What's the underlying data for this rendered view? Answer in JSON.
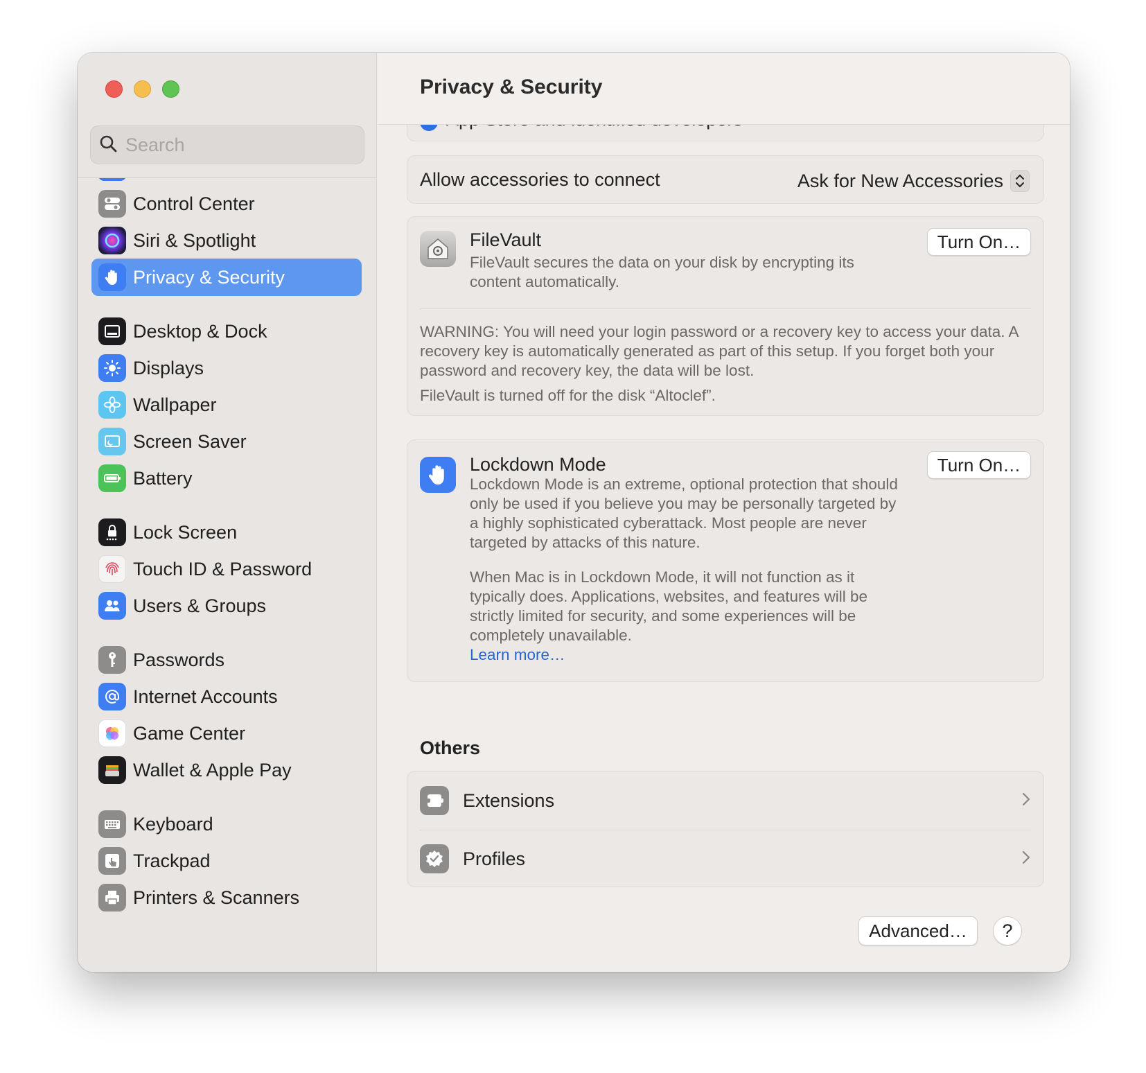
{
  "window": {
    "title": "Privacy & Security"
  },
  "search": {
    "placeholder": "Search"
  },
  "sidebar": {
    "items": [
      {
        "label": "Control Center",
        "icon": "control-center-icon"
      },
      {
        "label": "Siri & Spotlight",
        "icon": "siri-icon"
      },
      {
        "label": "Privacy & Security",
        "icon": "hand-icon",
        "selected": true
      },
      {
        "label": "Desktop & Dock",
        "icon": "dock-icon"
      },
      {
        "label": "Displays",
        "icon": "sun-icon"
      },
      {
        "label": "Wallpaper",
        "icon": "flower-icon"
      },
      {
        "label": "Screen Saver",
        "icon": "screen-saver-icon"
      },
      {
        "label": "Battery",
        "icon": "battery-icon"
      },
      {
        "label": "Lock Screen",
        "icon": "lock-icon"
      },
      {
        "label": "Touch ID & Password",
        "icon": "fingerprint-icon"
      },
      {
        "label": "Users & Groups",
        "icon": "users-icon"
      },
      {
        "label": "Passwords",
        "icon": "key-icon"
      },
      {
        "label": "Internet Accounts",
        "icon": "at-icon"
      },
      {
        "label": "Game Center",
        "icon": "game-center-icon"
      },
      {
        "label": "Wallet & Apple Pay",
        "icon": "wallet-icon"
      },
      {
        "label": "Keyboard",
        "icon": "keyboard-icon"
      },
      {
        "label": "Trackpad",
        "icon": "trackpad-icon"
      },
      {
        "label": "Printers & Scanners",
        "icon": "printer-icon"
      }
    ]
  },
  "main": {
    "cut_off_option": "App Store and identified developers",
    "accessories": {
      "label": "Allow accessories to connect",
      "value": "Ask for New Accessories"
    },
    "filevault": {
      "title": "FileVault",
      "description": "FileVault secures the data on your disk by encrypting its content automatically.",
      "button": "Turn On…",
      "warning": "WARNING: You will need your login password or a recovery key to access your data. A recovery key is automatically generated as part of this setup. If you forget both your password and recovery key, the data will be lost.",
      "status": "FileVault is turned off for the disk “Altoclef”."
    },
    "lockdown": {
      "title": "Lockdown Mode",
      "description1": "Lockdown Mode is an extreme, optional protection that should only be used if you believe you may be personally targeted by a highly sophisticated cyberattack. Most people are never targeted by attacks of this nature.",
      "description2": "When Mac is in Lockdown Mode, it will not function as it typically does. Applications, websites, and features will be strictly limited for security, and some experiences will be completely unavailable.",
      "learn_more": "Learn more…",
      "button": "Turn On…"
    },
    "others": {
      "title": "Others",
      "rows": [
        {
          "label": "Extensions",
          "icon": "extensions-icon"
        },
        {
          "label": "Profiles",
          "icon": "profiles-icon"
        }
      ]
    },
    "footer": {
      "advanced_button": "Advanced…",
      "help_button": "?"
    }
  },
  "colors": {
    "accent": "#5d97ef",
    "link": "#2466d6",
    "traffic_red": "#ed5f57",
    "traffic_yellow": "#f5be4f",
    "traffic_green": "#5fc454"
  }
}
